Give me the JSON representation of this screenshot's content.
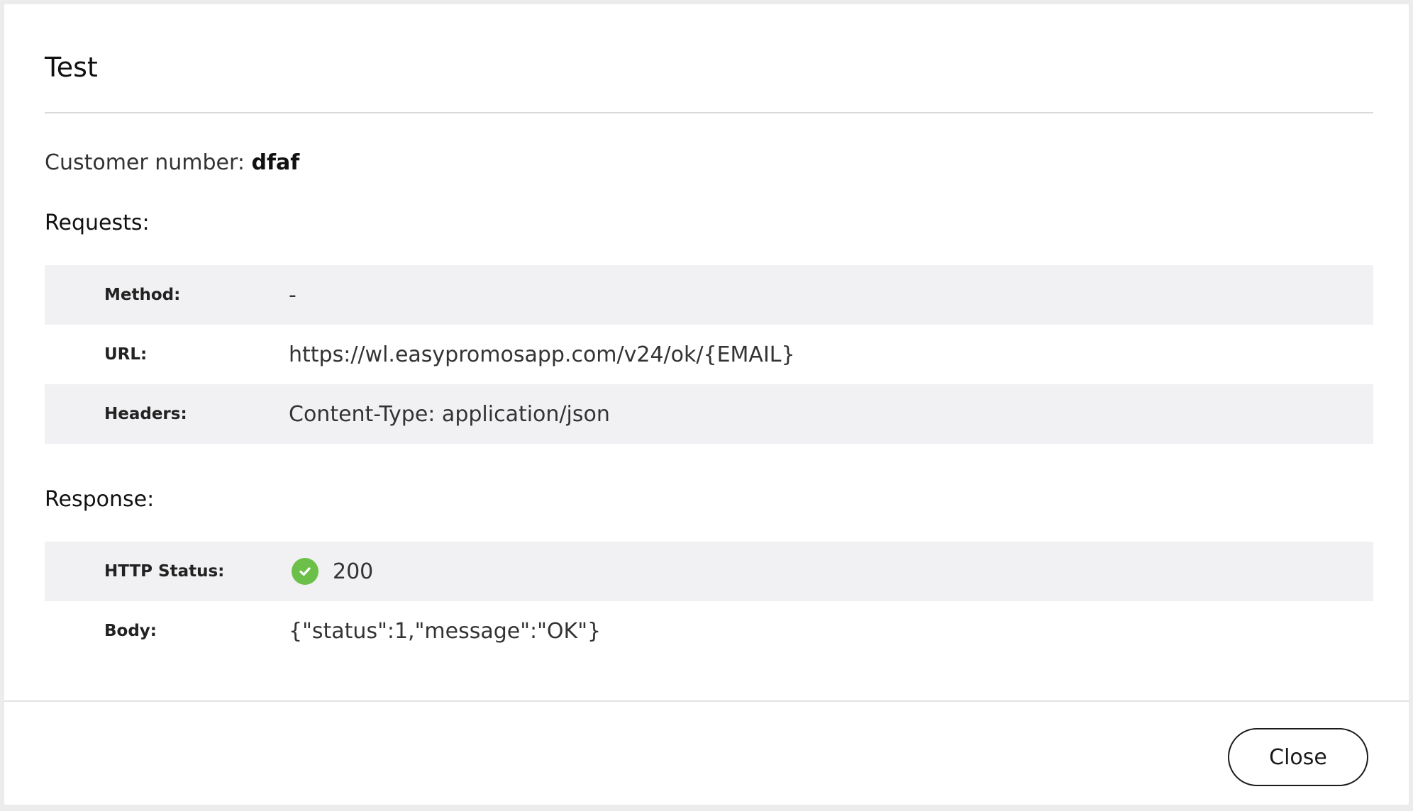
{
  "modal": {
    "title": "Test",
    "customer": {
      "label": "Customer number:",
      "value": "dfaf"
    },
    "requests": {
      "title": "Requests:",
      "rows": [
        {
          "label": "Method:",
          "value": "-"
        },
        {
          "label": "URL:",
          "value": "https://wl.easypromosapp.com/v24/ok/{EMAIL}"
        },
        {
          "label": "Headers:",
          "value": "Content-Type: application/json"
        }
      ]
    },
    "response": {
      "title": "Response:",
      "rows": [
        {
          "label": "HTTP Status:",
          "value": "200",
          "icon": "check-circle-icon",
          "icon_color": "#6cc04a"
        },
        {
          "label": "Body:",
          "value": "{\"status\":1,\"message\":\"OK\"}"
        }
      ]
    },
    "footer": {
      "close_label": "Close"
    }
  }
}
